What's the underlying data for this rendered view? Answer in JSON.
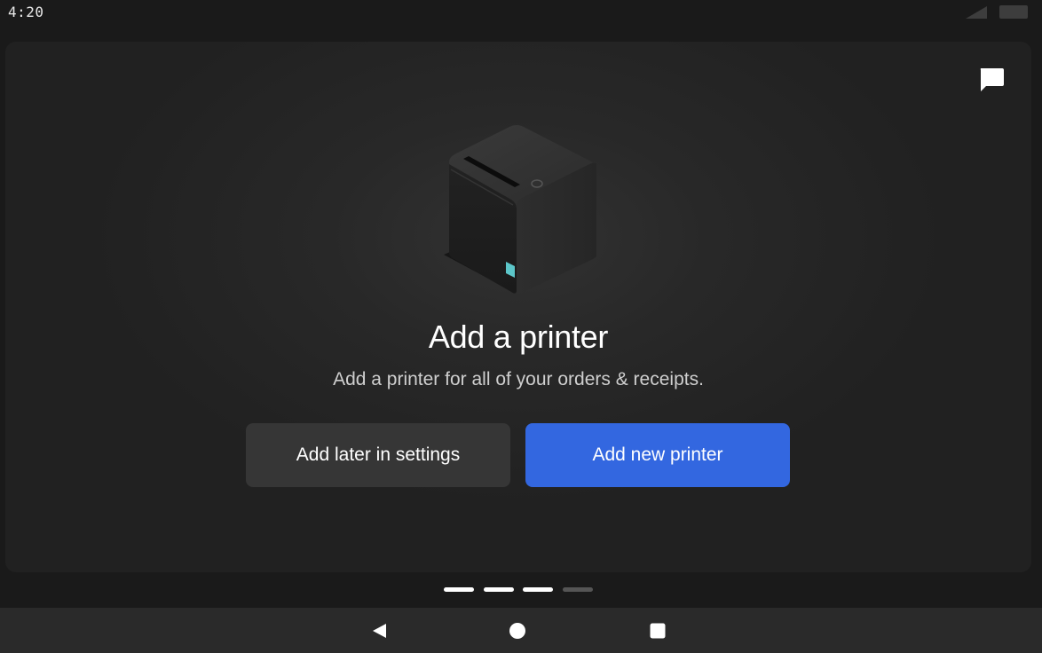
{
  "status_bar": {
    "time": "4:20",
    "icons": [
      "signal-icon",
      "battery-icon"
    ]
  },
  "card": {
    "chat_icon": "chat-bubble-icon",
    "illustration": "receipt-printer-illustration",
    "title": "Add a printer",
    "subtitle": "Add a printer for all of your orders & receipts.",
    "secondary_button_label": "Add later in settings",
    "primary_button_label": "Add new printer"
  },
  "pager": {
    "total_steps": 4,
    "active_steps": 3
  },
  "nav_bar": {
    "icons": [
      "back-icon",
      "home-icon",
      "recents-icon"
    ]
  },
  "colors": {
    "accent": "#3367e0",
    "background": "#1a1a1a",
    "card": "#212121",
    "secondary_button": "#363636",
    "printer_indicator": "#5cc6c9"
  }
}
